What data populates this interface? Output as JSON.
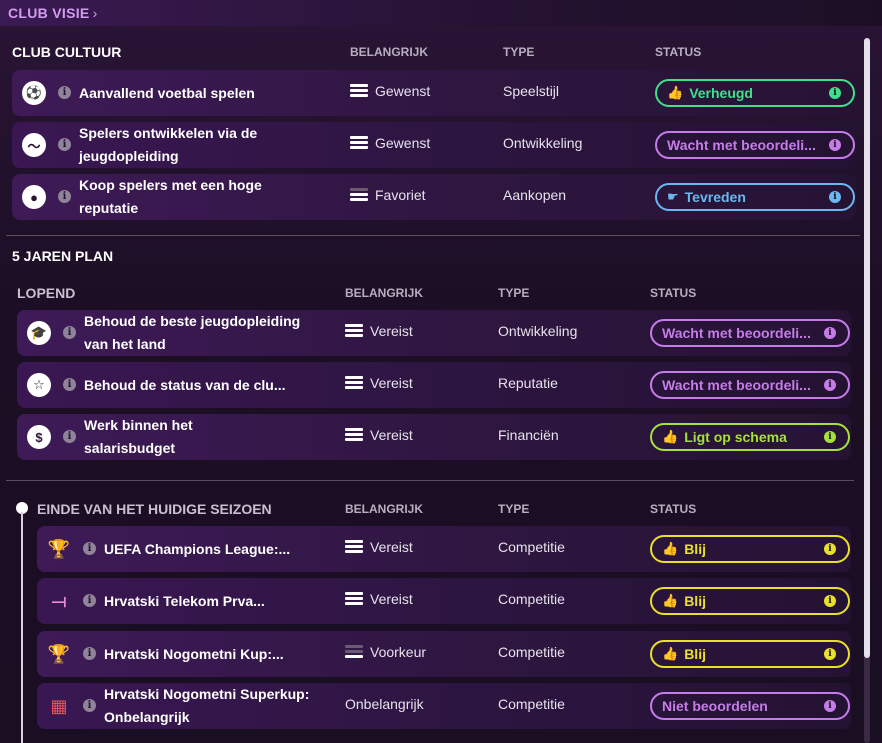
{
  "breadcrumb": {
    "label": "CLUB VISIE",
    "chevron": "›"
  },
  "columns": {
    "importance": "BELANGRIJK",
    "type": "TYPE",
    "status": "STATUS"
  },
  "club_cultuur": {
    "title": "CLUB CULTUUR",
    "rows": [
      {
        "icon": "football-icon",
        "name": "Aanvallend voetbal spelen",
        "importance": "Gewenst",
        "type": "Speelstijl",
        "status": "Verheugd",
        "status_color": "green"
      },
      {
        "icon": "growth-chart-icon",
        "name": "Spelers ontwikkelen via de jeugdopleiding",
        "importance": "Gewenst",
        "type": "Ontwikkeling",
        "status": "Wacht met beoordeli...",
        "status_color": "purple"
      },
      {
        "icon": "player-icon",
        "name": "Koop spelers met een hoge reputatie",
        "importance": "Favoriet",
        "type": "Aankopen",
        "status": "Tevreden",
        "status_color": "blue"
      }
    ]
  },
  "plan": {
    "title": "5 JAREN PLAN",
    "lopend": {
      "title": "LOPEND",
      "rows": [
        {
          "icon": "graduation-cap-icon",
          "name": "Behoud de beste jeugdopleiding van het land",
          "importance": "Vereist",
          "type": "Ontwikkeling",
          "status": "Wacht met beoordeli...",
          "status_color": "purple"
        },
        {
          "icon": "star-icon",
          "name": "Behoud de status van de clu...",
          "importance": "Vereist",
          "type": "Reputatie",
          "status": "Wacht met beoordeli...",
          "status_color": "purple"
        },
        {
          "icon": "money-icon",
          "name": "Werk binnen het salarisbudget",
          "importance": "Vereist",
          "type": "Financiën",
          "status": "Ligt op schema",
          "status_color": "lime"
        }
      ]
    },
    "einde": {
      "title": "EINDE VAN HET HUIDIGE SEIZOEN",
      "rows": [
        {
          "icon": "trophy-icon",
          "name": "UEFA Champions League:...",
          "importance": "Vereist",
          "type": "Competitie",
          "status": "Blij",
          "status_color": "yellow"
        },
        {
          "icon": "league-logo-icon",
          "name": "Hrvatski Telekom Prva...",
          "importance": "Vereist",
          "type": "Competitie",
          "status": "Blij",
          "status_color": "yellow"
        },
        {
          "icon": "cup-icon",
          "name": "Hrvatski Nogometni Kup:...",
          "importance": "Voorkeur",
          "type": "Competitie",
          "status": "Blij",
          "status_color": "yellow"
        },
        {
          "icon": "crest-icon",
          "name": "Hrvatski Nogometni Superkup: Onbelangrijk",
          "importance": "Onbelangrijk",
          "type": "Competitie",
          "status": "Niet beoordelen",
          "status_color": "purple"
        }
      ]
    }
  }
}
